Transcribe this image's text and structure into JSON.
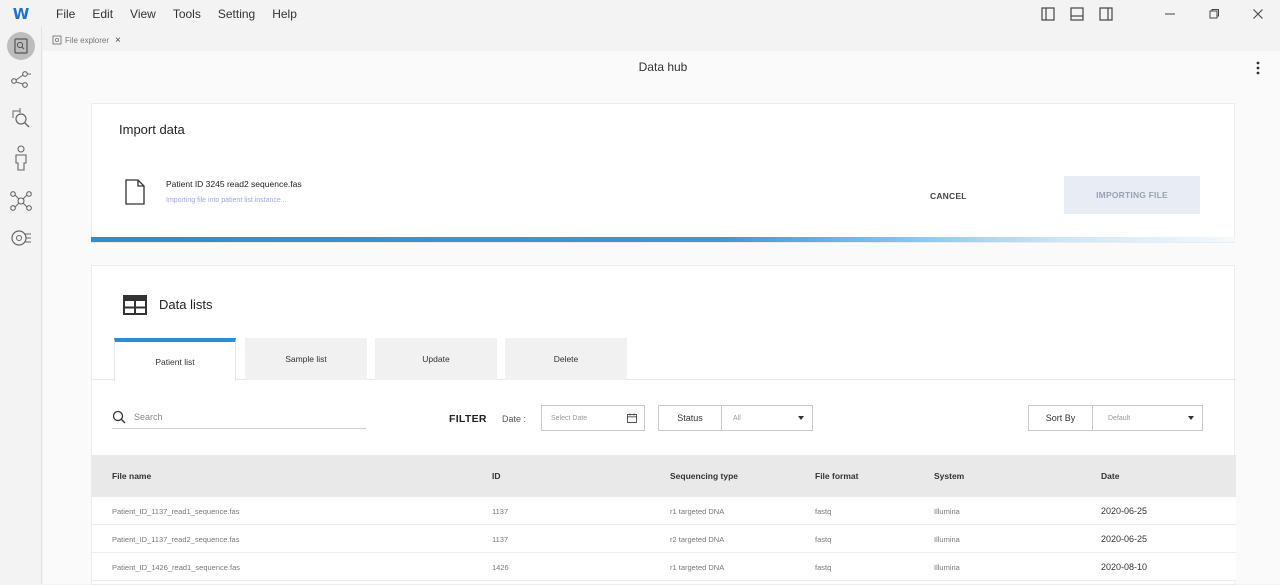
{
  "app": {
    "logo": "W",
    "menu": [
      "File",
      "Edit",
      "View",
      "Tools",
      "Setting",
      "Help"
    ]
  },
  "tabstrip": {
    "file_tab": "File explorer",
    "close": "×"
  },
  "page": {
    "title": "Data hub"
  },
  "import_card": {
    "title": "Import data",
    "file_name": "Patient ID 3245 read2 sequence.fas",
    "status_text": "Importing file into patient list instance...",
    "cancel_label": "CANCEL",
    "importing_label": "IMPORTING FILE",
    "progress_percent": 100
  },
  "lists_card": {
    "title": "Data lists",
    "tabs": [
      {
        "label": "Patient list",
        "active": true
      },
      {
        "label": "Sample list",
        "active": false
      },
      {
        "label": "Update",
        "active": false
      },
      {
        "label": "Delete",
        "active": false
      }
    ],
    "search_placeholder": "Search",
    "filter_label": "FILTER",
    "date_label": "Date :",
    "date_placeholder": "Select Date",
    "status_label": "Status",
    "status_value": "All",
    "sort_label": "Sort By",
    "sort_value": "Default",
    "columns": [
      "File name",
      "ID",
      "Sequencing type",
      "File format",
      "System",
      "Date"
    ],
    "rows": [
      {
        "file_name": "Patient_ID_1137_read1_sequence.fas",
        "id": "1137",
        "seq_type": "r1 targeted DNA",
        "format": "fastq",
        "system": "Illumina",
        "date": "2020-06-25"
      },
      {
        "file_name": "Patient_ID_1137_read2_sequence.fas",
        "id": "1137",
        "seq_type": "r2 targeted DNA",
        "format": "fastq",
        "system": "Illumina",
        "date": "2020-06-25"
      },
      {
        "file_name": "Patient_ID_1426_read1_sequence.fas",
        "id": "1426",
        "seq_type": "r1 targeted DNA",
        "format": "fastq",
        "system": "Illumina",
        "date": "2020-08-10"
      }
    ]
  },
  "colors": {
    "accent": "#2a8fcf",
    "brand": "#1e74c7",
    "status_text": "#9aa8e8"
  },
  "icons": {
    "sidebar": [
      "file-explorer-icon",
      "workflow-icon",
      "search-analysis-icon",
      "person-icon",
      "network-icon",
      "settings-analysis-icon"
    ]
  }
}
